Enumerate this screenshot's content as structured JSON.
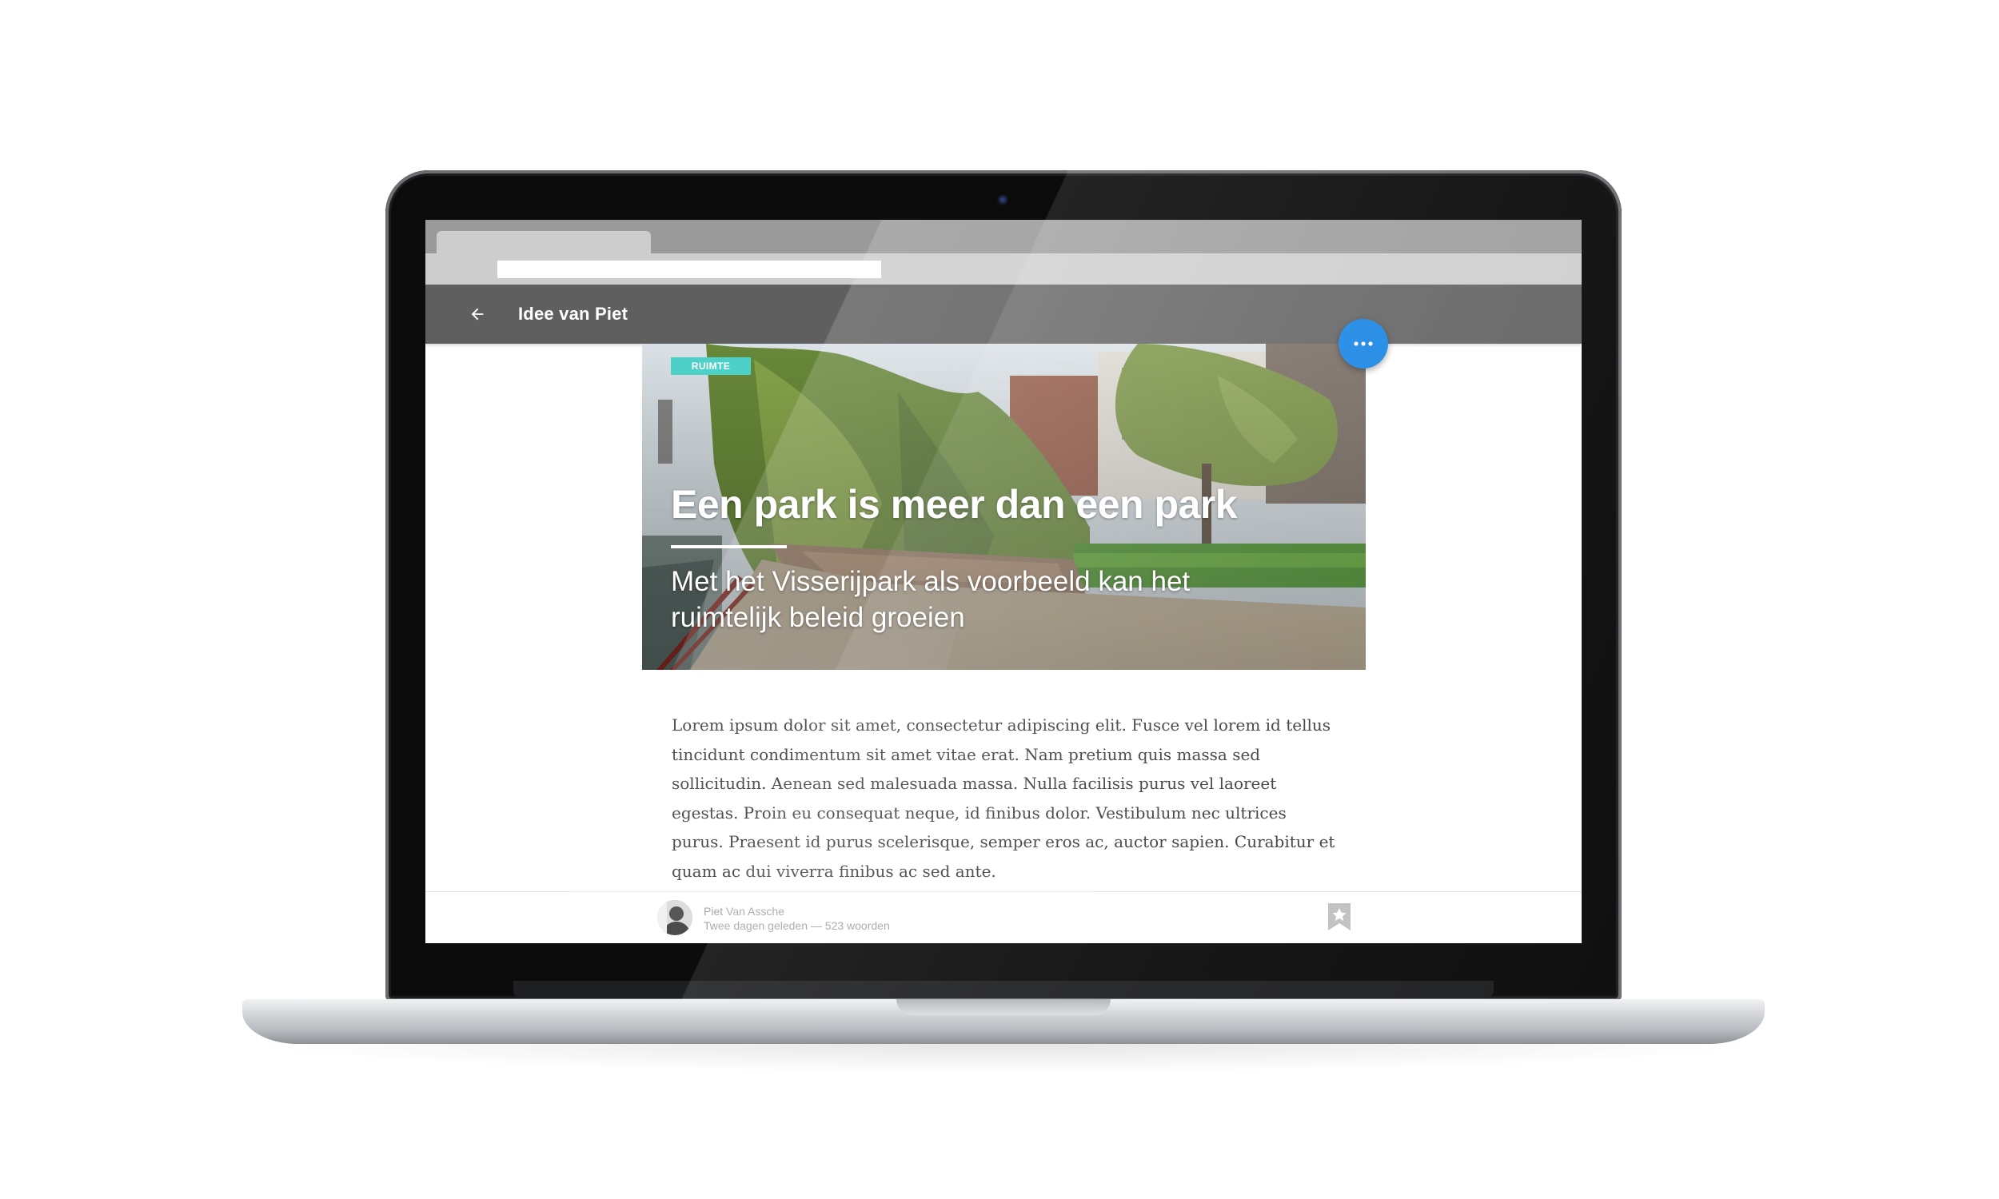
{
  "app_bar": {
    "title": "Idee van Piet",
    "back_icon": "arrow-left-icon"
  },
  "fab": {
    "icon": "more-horizontal-icon",
    "color": "#1e88e5"
  },
  "hero": {
    "tag": "RUIMTE",
    "tag_color": "#4dd0c8",
    "title": "Een park is meer dan een park",
    "subtitle": "Met het Visserijpark als voorbeeld kan het ruimtelijk beleid groeien"
  },
  "article": {
    "body": "Lorem ipsum dolor sit amet, consectetur adipiscing elit. Fusce vel lorem id tellus tincidunt condimentum sit amet vitae erat. Nam pretium quis massa sed sollicitudin. Aenean sed malesuada massa. Nulla facilisis purus vel laoreet egestas. Proin eu consequat neque, id finibus dolor. Vestibulum nec ultrices purus. Praesent id purus scelerisque, semper eros ac, auctor sapien. Curabitur et quam ac dui viverra finibus ac sed ante."
  },
  "footer": {
    "author": "Piet Van Assche",
    "meta": "Twee dagen geleden — 523 woorden",
    "bookmark_icon": "bookmark-star-icon"
  },
  "colors": {
    "app_bar": "#5f5f5f",
    "accent": "#1e88e5"
  }
}
